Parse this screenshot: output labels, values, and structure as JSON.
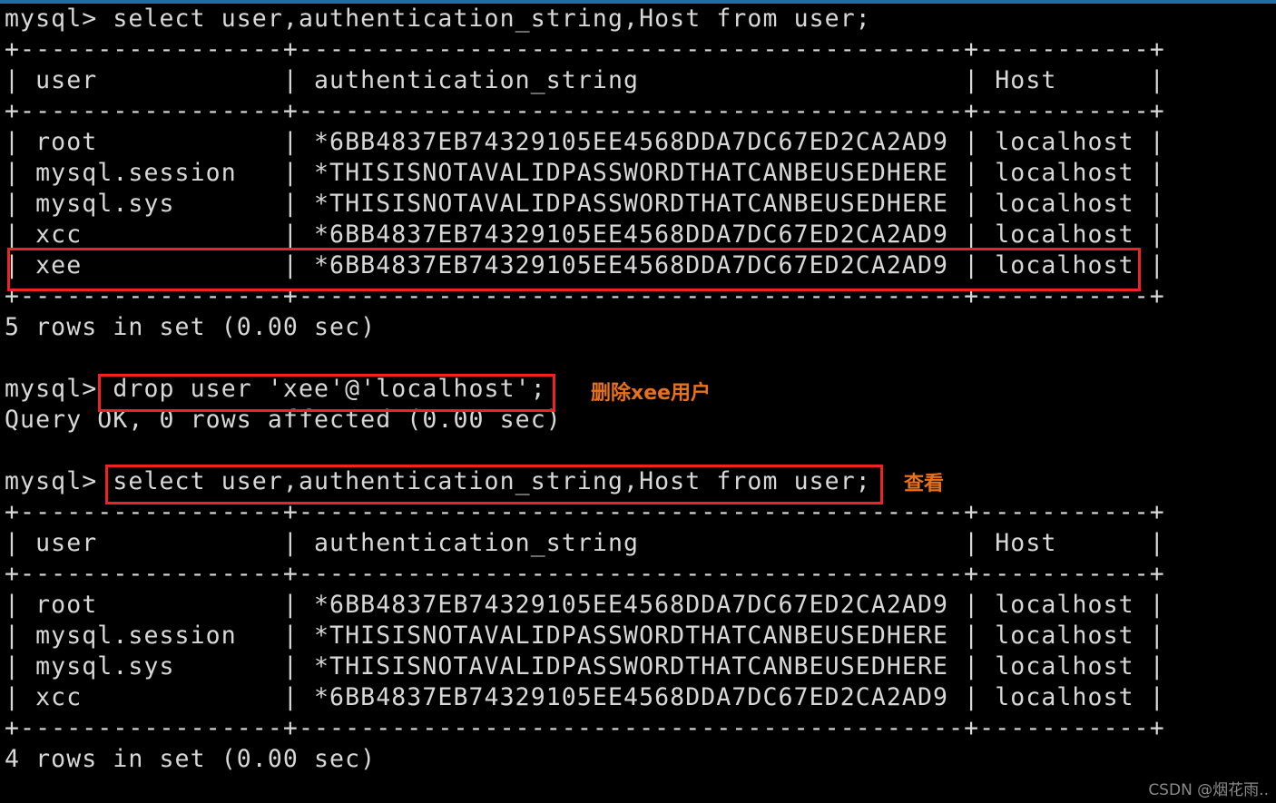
{
  "window": {
    "kind": "mysql-terminal",
    "background_color": "#000000",
    "foreground_color": "#d8d8d8",
    "top_rule_color": "#1d6fa5"
  },
  "terminal": {
    "lines": [
      "mysql> select user,authentication_string,Host from user;",
      "+-----------------+-------------------------------------------+-----------+",
      "| user            | authentication_string                     | Host      |",
      "+-----------------+-------------------------------------------+-----------+",
      "| root            | *6BB4837EB74329105EE4568DDA7DC67ED2CA2AD9 | localhost |",
      "| mysql.session   | *THISISNOTAVALIDPASSWORDTHATCANBEUSEDHERE | localhost |",
      "| mysql.sys       | *THISISNOTAVALIDPASSWORDTHATCANBEUSEDHERE | localhost |",
      "| xcc             | *6BB4837EB74329105EE4568DDA7DC67ED2CA2AD9 | localhost |",
      "| xee             | *6BB4837EB74329105EE4568DDA7DC67ED2CA2AD9 | localhost |",
      "+-----------------+-------------------------------------------+-----------+",
      "5 rows in set (0.00 sec)",
      "",
      "mysql> drop user 'xee'@'localhost';",
      "Query OK, 0 rows affected (0.00 sec)",
      "",
      "mysql> select user,authentication_string,Host from user;",
      "+-----------------+-------------------------------------------+-----------+",
      "| user            | authentication_string                     | Host      |",
      "+-----------------+-------------------------------------------+-----------+",
      "| root            | *6BB4837EB74329105EE4568DDA7DC67ED2CA2AD9 | localhost |",
      "| mysql.session   | *THISISNOTAVALIDPASSWORDTHATCANBEUSEDHERE | localhost |",
      "| mysql.sys       | *THISISNOTAVALIDPASSWORDTHATCANBEUSEDHERE | localhost |",
      "| xcc             | *6BB4837EB74329105EE4568DDA7DC67ED2CA2AD9 | localhost |",
      "+-----------------+-------------------------------------------+-----------+",
      "4 rows in set (0.00 sec)"
    ],
    "prompt": "mysql>",
    "queries": [
      "select user,authentication_string,Host from user;",
      "drop user 'xee'@'localhost';",
      "select user,authentication_string,Host from user;"
    ],
    "results": [
      "5 rows in set (0.00 sec)",
      "Query OK, 0 rows affected (0.00 sec)",
      "4 rows in set (0.00 sec)"
    ]
  },
  "table_before": {
    "headers": [
      "user",
      "authentication_string",
      "Host"
    ],
    "rows": [
      [
        "root",
        "*6BB4837EB74329105EE4568DDA7DC67ED2CA2AD9",
        "localhost"
      ],
      [
        "mysql.session",
        "*THISISNOTAVALIDPASSWORDTHATCANBEUSEDHERE",
        "localhost"
      ],
      [
        "mysql.sys",
        "*THISISNOTAVALIDPASSWORDTHATCANBEUSEDHERE",
        "localhost"
      ],
      [
        "xcc",
        "*6BB4837EB74329105EE4568DDA7DC67ED2CA2AD9",
        "localhost"
      ],
      [
        "xee",
        "*6BB4837EB74329105EE4568DDA7DC67ED2CA2AD9",
        "localhost"
      ]
    ],
    "row_count_text": "5 rows in set (0.00 sec)"
  },
  "table_after": {
    "headers": [
      "user",
      "authentication_string",
      "Host"
    ],
    "rows": [
      [
        "root",
        "*6BB4837EB74329105EE4568DDA7DC67ED2CA2AD9",
        "localhost"
      ],
      [
        "mysql.session",
        "*THISISNOTAVALIDPASSWORDTHATCANBEUSEDHERE",
        "localhost"
      ],
      [
        "mysql.sys",
        "*THISISNOTAVALIDPASSWORDTHATCANBEUSEDHERE",
        "localhost"
      ],
      [
        "xcc",
        "*6BB4837EB74329105EE4568DDA7DC67ED2CA2AD9",
        "localhost"
      ]
    ],
    "row_count_text": "4 rows in set (0.00 sec)"
  },
  "annotations": {
    "color": "#e8711a",
    "highlight_color": "#ef2323",
    "items": [
      {
        "text": "删除xee用户",
        "for": "drop-user-command"
      },
      {
        "text": "查看",
        "for": "select-users-command"
      }
    ]
  },
  "watermark": {
    "text": "CSDN @烟花雨..",
    "color": "#8a8a8a"
  }
}
